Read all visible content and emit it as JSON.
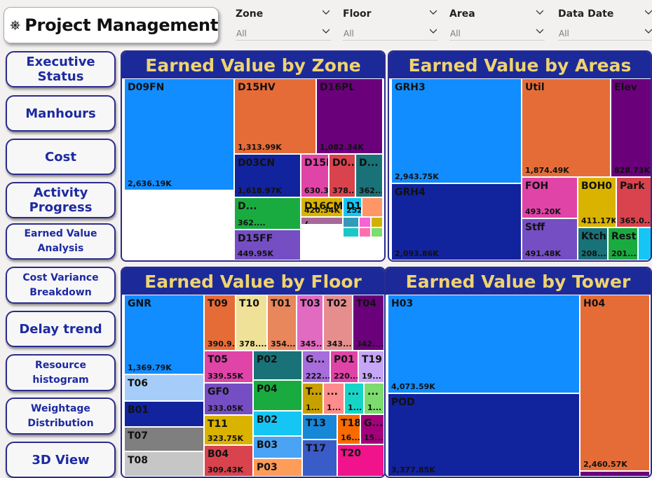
{
  "header": {
    "title": "Project Management",
    "logo_icon": "ship-wheel-icon"
  },
  "filters": [
    {
      "id": "zone",
      "label": "Zone",
      "value": "All"
    },
    {
      "id": "floor",
      "label": "Floor",
      "value": "All"
    },
    {
      "id": "area",
      "label": "Area",
      "value": "All"
    },
    {
      "id": "data-date",
      "label": "Data Date",
      "value": "All"
    }
  ],
  "nav": [
    {
      "id": "executive-status",
      "label": "Executive Status",
      "size": "big"
    },
    {
      "id": "manhours",
      "label": "Manhours",
      "size": "big"
    },
    {
      "id": "cost",
      "label": "Cost",
      "size": "big"
    },
    {
      "id": "activity-progress",
      "label": "Activity Progress",
      "size": "big"
    },
    {
      "id": "earned-value-analysis",
      "label": "Earned Value\nAnalysis",
      "size": "small"
    },
    {
      "id": "cost-variance-breakdown",
      "label": "Cost Variance\nBreakdown",
      "size": "small"
    },
    {
      "id": "delay-trend",
      "label": "Delay trend",
      "size": "big"
    },
    {
      "id": "resource-histogram",
      "label": "Resource\nhistogram",
      "size": "small"
    },
    {
      "id": "weightage-distribution",
      "label": "Weightage\nDistribution",
      "size": "small"
    },
    {
      "id": "3d-view",
      "label": "3D View",
      "size": "big"
    }
  ],
  "charts": {
    "zone": {
      "title": "Earned Value by Zone",
      "chart_data": {
        "type": "treemap",
        "items": [
          {
            "name": "D09FN",
            "value": "2,636.19K",
            "color": "#118dff"
          },
          {
            "name": "D15HV",
            "value": "1,313.99K",
            "color": "#e66c37"
          },
          {
            "name": "D16PL",
            "value": "1,082.34K",
            "color": "#6b007b"
          },
          {
            "name": "D03CN",
            "value": "1,618.97K",
            "color": "#12239e"
          },
          {
            "name": "D15PL",
            "value": "630.39K",
            "color": "#e044a7"
          },
          {
            "name": "D0...",
            "value": "378....",
            "color": "#d9434d"
          },
          {
            "name": "D...",
            "value": "362....",
            "color": "#197278"
          },
          {
            "name": "D...",
            "value": "362....",
            "color": "#1aab40"
          },
          {
            "name": "D15FF",
            "value": "449.95K",
            "color": "#744ec2"
          },
          {
            "name": "D16CM",
            "value": "420.34K",
            "color": "#d9b300"
          },
          {
            "name": "D16FA",
            "value": "252.37K",
            "color": "#15c6f4"
          },
          {
            "name": "",
            "value": "",
            "color": "#fe9666"
          },
          {
            "name": "(...",
            "value": "",
            "color": "#a66999"
          },
          {
            "name": "",
            "value": "",
            "color": "#3599b8"
          },
          {
            "name": "",
            "value": "",
            "color": "#f564d4"
          },
          {
            "name": "",
            "value": "",
            "color": "#d0b100"
          },
          {
            "name": "",
            "value": "",
            "color": "#1bc8c8"
          },
          {
            "name": "",
            "value": "",
            "color": "#ff6fb0"
          },
          {
            "name": "",
            "value": "",
            "color": "#7cdc6d"
          }
        ]
      }
    },
    "areas": {
      "title": "Earned Value by Areas",
      "chart_data": {
        "type": "treemap",
        "items": [
          {
            "name": "GRH3",
            "value": "2,943.75K",
            "color": "#118dff"
          },
          {
            "name": "Util",
            "value": "1,874.49K",
            "color": "#e66c37"
          },
          {
            "name": "Elev",
            "value": "828.73K",
            "color": "#6b007b"
          },
          {
            "name": "GRH4",
            "value": "2,093.86K",
            "color": "#12239e"
          },
          {
            "name": "FOH",
            "value": "493.20K",
            "color": "#e044a7"
          },
          {
            "name": "BOH0",
            "value": "411.17K",
            "color": "#d9b300"
          },
          {
            "name": "Park",
            "value": "365.0...",
            "color": "#d9434d"
          },
          {
            "name": "Stff",
            "value": "491.48K",
            "color": "#744ec2"
          },
          {
            "name": "Ktch",
            "value": "208....",
            "color": "#197278"
          },
          {
            "name": "Rest",
            "value": "201....",
            "color": "#1aab40"
          },
          {
            "name": "",
            "value": "",
            "color": "#15c6f4"
          }
        ]
      }
    },
    "floor": {
      "title": "Earned Value by Floor",
      "chart_data": {
        "type": "treemap",
        "items": [
          {
            "name": "GNR",
            "value": "1,369.79K",
            "color": "#118dff"
          },
          {
            "name": "T09",
            "value": "390.9...",
            "color": "#e66c37"
          },
          {
            "name": "T10",
            "value": "378....",
            "color": "#f0e199"
          },
          {
            "name": "T01",
            "value": "354....",
            "color": "#e8875c"
          },
          {
            "name": "T03",
            "value": "345....",
            "color": "#e06bc0"
          },
          {
            "name": "T02",
            "value": "343....",
            "color": "#e68e8e"
          },
          {
            "name": "T04",
            "value": "342....",
            "color": "#6b007b"
          },
          {
            "name": "T06",
            "value": "",
            "color": "#a6cdfa"
          },
          {
            "name": "T05",
            "value": "339.55K",
            "color": "#e044a7"
          },
          {
            "name": "P02",
            "value": "",
            "color": "#197278"
          },
          {
            "name": "G...",
            "value": "222....",
            "color": "#a66ddb"
          },
          {
            "name": "P01",
            "value": "220....",
            "color": "#e044a7"
          },
          {
            "name": "T19",
            "value": "19...",
            "color": "#c6a6f6"
          },
          {
            "name": "B01",
            "value": "",
            "color": "#12239e"
          },
          {
            "name": "GF0",
            "value": "333.05K",
            "color": "#744ec2"
          },
          {
            "name": "P04",
            "value": "",
            "color": "#1aab40"
          },
          {
            "name": "T...",
            "value": "1...",
            "color": "#c8a000"
          },
          {
            "name": "...",
            "value": "1...",
            "color": "#fe8c8c"
          },
          {
            "name": "...",
            "value": "1...",
            "color": "#15d6c6"
          },
          {
            "name": "...",
            "value": "1...",
            "color": "#7cdc6d"
          },
          {
            "name": "T07",
            "value": "",
            "color": "#7f7f7f"
          },
          {
            "name": "T11",
            "value": "323.75K",
            "color": "#d9b300"
          },
          {
            "name": "B02",
            "value": "",
            "color": "#15c6f4"
          },
          {
            "name": "T13",
            "value": "",
            "color": "#1787d8"
          },
          {
            "name": "T18",
            "value": "16...",
            "color": "#f76b00"
          },
          {
            "name": "G...",
            "value": "15...",
            "color": "#a4007b"
          },
          {
            "name": "T08",
            "value": "",
            "color": "#c6c6c6"
          },
          {
            "name": "B04",
            "value": "309.43K",
            "color": "#d9434d"
          },
          {
            "name": "B03",
            "value": "",
            "color": "#4aa3f5"
          },
          {
            "name": "P03",
            "value": "",
            "color": "#fe9c5a"
          },
          {
            "name": "T17",
            "value": "",
            "color": "#3a5cc8"
          },
          {
            "name": "T20",
            "value": "",
            "color": "#f0138b"
          }
        ]
      }
    },
    "tower": {
      "title": "Earned Value by Tower",
      "chart_data": {
        "type": "treemap",
        "items": [
          {
            "name": "H03",
            "value": "4,073.59K",
            "color": "#118dff"
          },
          {
            "name": "H04",
            "value": "2,460.57K",
            "color": "#e66c37"
          },
          {
            "name": "POD",
            "value": "3,377.85K",
            "color": "#12239e"
          },
          {
            "name": "",
            "value": "",
            "color": "#6b007b"
          }
        ]
      }
    }
  }
}
